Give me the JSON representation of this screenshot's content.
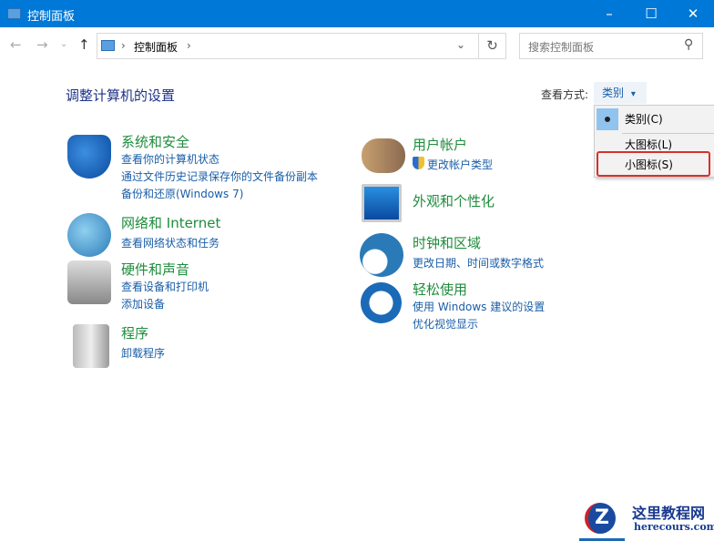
{
  "window": {
    "title": "控制面板",
    "minimize": "–",
    "maximize": "☐",
    "close": "✕"
  },
  "nav": {
    "back": "←",
    "forward": "→",
    "recent": "⌄",
    "up": "↑",
    "breadcrumb": [
      "控制面板"
    ],
    "sep": "›",
    "dropdown": "⌄",
    "refresh": "↻",
    "search_placeholder": "搜索控制面板",
    "search_icon": "⚲"
  },
  "heading": "调整计算机的设置",
  "view": {
    "label": "查看方式:",
    "selected": "类别",
    "arrow": "▾",
    "options": [
      {
        "label": "类别(C)",
        "checked": true
      },
      {
        "label": "大图标(L)"
      },
      {
        "label": "小图标(S)",
        "highlighted": true
      }
    ]
  },
  "categories": [
    {
      "title": "系统和安全",
      "links": [
        "查看你的计算机状态",
        "通过文件历史记录保存你的文件备份副本",
        "备份和还原(Windows 7)"
      ]
    },
    {
      "title": "网络和 Internet",
      "links": [
        "查看网络状态和任务"
      ]
    },
    {
      "title": "硬件和声音",
      "links": [
        "查看设备和打印机",
        "添加设备"
      ]
    },
    {
      "title": "程序",
      "links": [
        "卸载程序"
      ]
    },
    {
      "title": "用户帐户",
      "links": [
        "更改帐户类型"
      ]
    },
    {
      "title": "外观和个性化",
      "links": []
    },
    {
      "title": "时钟和区域",
      "links": [
        "更改日期、时间或数字格式"
      ]
    },
    {
      "title": "轻松使用",
      "links": [
        "使用 Windows 建议的设置",
        "优化视觉显示"
      ]
    }
  ],
  "watermark": {
    "name": "这里教程网",
    "url": "herecours.com"
  },
  "colors": {
    "titlebar": "#0078d7",
    "title": "#1e8c3c",
    "link": "#1a5ea8",
    "highlight": "#d9302a"
  }
}
